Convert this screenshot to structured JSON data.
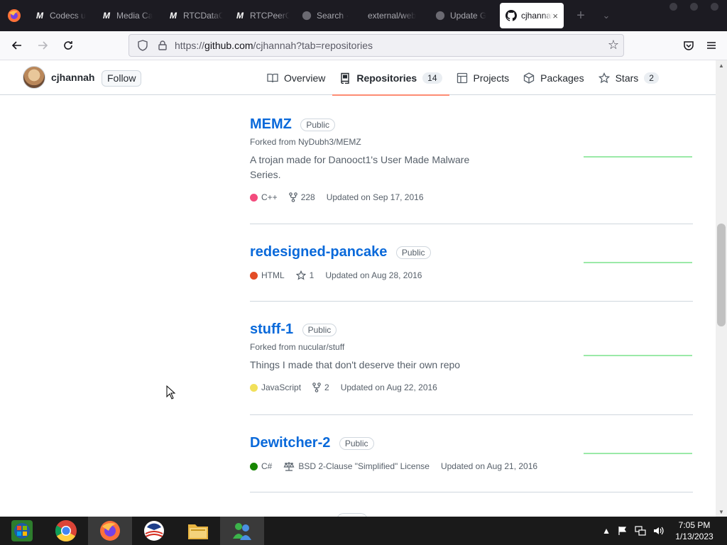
{
  "browser": {
    "tabs": [
      {
        "title": "Codecs u",
        "favicon": "M"
      },
      {
        "title": "Media Ca",
        "favicon": "M"
      },
      {
        "title": "RTCDataC",
        "favicon": "M"
      },
      {
        "title": "RTCPeerC",
        "favicon": "M"
      },
      {
        "title": "Search · ",
        "favicon": "github"
      },
      {
        "title": "external/web",
        "favicon": ""
      },
      {
        "title": "Update G",
        "favicon": "github"
      }
    ],
    "active_tab": {
      "title": "cjhannah",
      "close": "×"
    },
    "new_tab": "+",
    "tab_list": "⌄",
    "url_prefix": "https://",
    "url_host": "github.com",
    "url_rest": "/cjhannah?tab=repositories"
  },
  "profile": {
    "username": "cjhannah",
    "follow_label": "Follow",
    "tabs": [
      {
        "label": "Overview",
        "icon": "book-icon",
        "count": ""
      },
      {
        "label": "Repositories",
        "icon": "repo-icon",
        "count": "14",
        "selected": true
      },
      {
        "label": "Projects",
        "icon": "project-table-icon",
        "count": ""
      },
      {
        "label": "Packages",
        "icon": "package-icon",
        "count": ""
      },
      {
        "label": "Stars",
        "icon": "star-icon",
        "count": "2"
      }
    ]
  },
  "repos": [
    {
      "name": "MEMZ",
      "visibility": "Public",
      "forked": "Forked from NyDubh3/MEMZ",
      "description": "A trojan made for Danooct1's User Made Malware Series.",
      "language": "C++",
      "lang_color": "#f34b7d",
      "stat_icon": "fork",
      "stat": "228",
      "license": "",
      "updated": "Updated on Sep 17, 2016"
    },
    {
      "name": "redesigned-pancake",
      "visibility": "Public",
      "forked": "",
      "description": "",
      "language": "HTML",
      "lang_color": "#e34c26",
      "stat_icon": "star",
      "stat": "1",
      "license": "",
      "updated": "Updated on Aug 28, 2016"
    },
    {
      "name": "stuff-1",
      "visibility": "Public",
      "forked": "Forked from nucular/stuff",
      "description": "Things I made that don't deserve their own repo",
      "language": "JavaScript",
      "lang_color": "#f1e05a",
      "stat_icon": "fork",
      "stat": "2",
      "license": "",
      "updated": "Updated on Aug 22, 2016"
    },
    {
      "name": "Dewitcher-2",
      "visibility": "Public",
      "forked": "",
      "description": "",
      "language": "C#",
      "lang_color": "#178600",
      "stat_icon": "",
      "stat": "",
      "license": "BSD 2-Clause \"Simplified\" License",
      "updated": "Updated on Aug 21, 2016"
    }
  ],
  "taskbar": {
    "time": "7:05 PM",
    "date": "1/13/2023"
  }
}
